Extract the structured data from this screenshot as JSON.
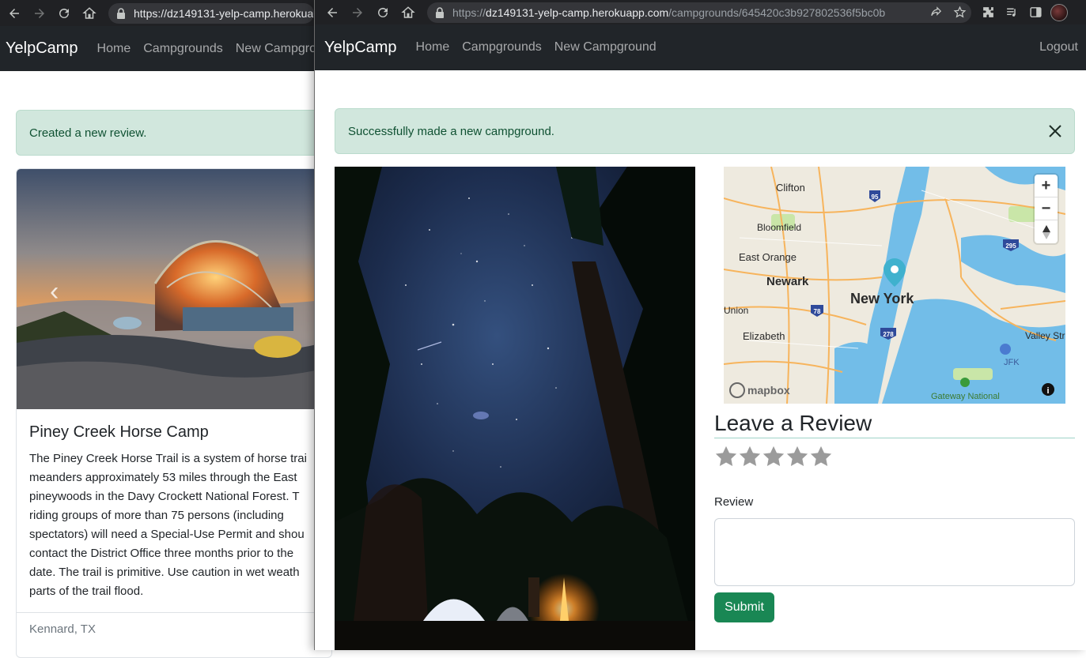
{
  "back_window": {
    "url_host": "https://dz149131-yelp-camp.herokua",
    "brand": "YelpCamp",
    "nav": [
      "Home",
      "Campgrounds",
      "New Campgro"
    ],
    "alert": "Created a new review.",
    "card": {
      "title": "Piney Creek Horse Camp",
      "text_lines": [
        "The Piney Creek Horse Trail is a system of horse trai",
        "meanders approximately 53 miles through the East",
        "pineywoods in the Davy Crockett National Forest. T",
        "riding groups of more than 75 persons (including",
        "spectators) will need a Special-Use Permit and shou",
        "contact the District Office three months prior to the",
        "date. The trail is primitive. Use caution in wet weath",
        "parts of the trail flood."
      ],
      "location": "Kennard, TX"
    }
  },
  "front_window": {
    "url_scheme": "https://",
    "url_host": "dz149131-yelp-camp.herokuapp.com",
    "url_path": "/campgrounds/645420c3b927802536f5bc0b",
    "brand": "YelpCamp",
    "nav": [
      "Home",
      "Campgrounds",
      "New Campground"
    ],
    "logout": "Logout",
    "alert": "Successfully made a new campground.",
    "map": {
      "labels": [
        "Clifton",
        "Bloomfield",
        "East Orange",
        "Newark",
        "New York",
        "Union",
        "Elizabeth",
        "Valley Str",
        "JFK",
        "Gateway National"
      ],
      "shields": [
        "95",
        "295",
        "78",
        "278"
      ],
      "attribution": "mapbox",
      "controls": [
        "+",
        "−"
      ]
    },
    "review": {
      "heading": "Leave a Review",
      "label": "Review",
      "submit": "Submit"
    }
  }
}
